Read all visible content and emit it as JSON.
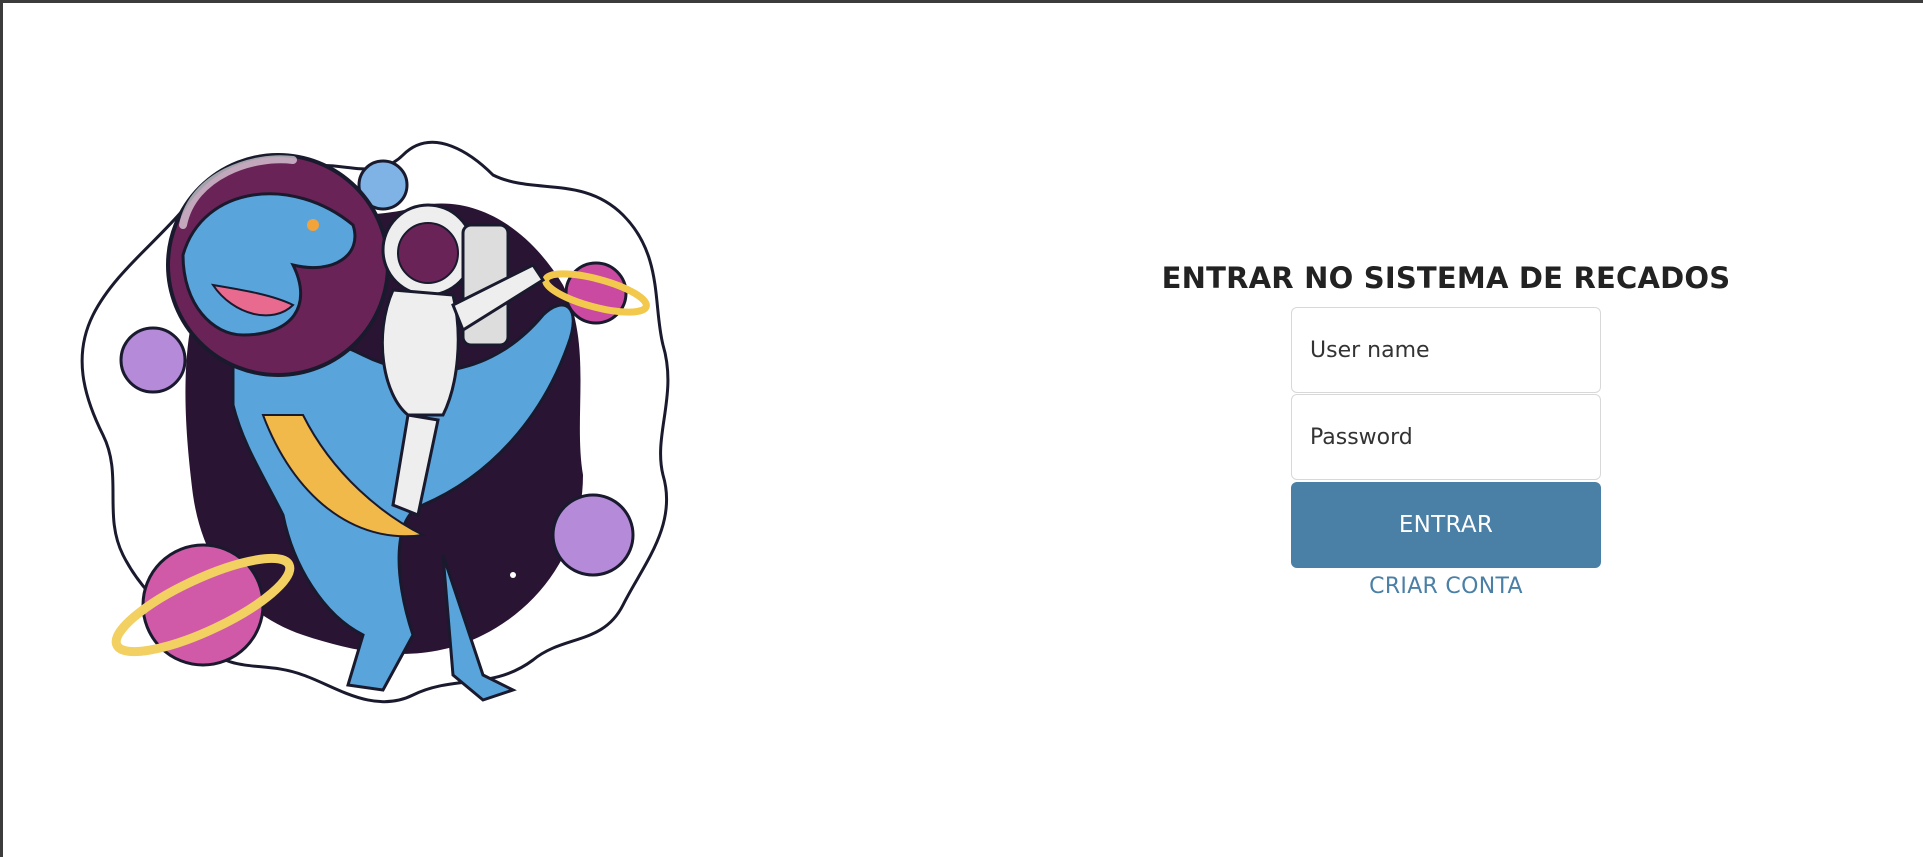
{
  "login": {
    "title": "ENTRAR NO SISTEMA DE RECADOS",
    "username_placeholder": "User name",
    "password_placeholder": "Password",
    "enter_label": "ENTRAR",
    "create_account_label": "CRIAR CONTA"
  },
  "colors": {
    "accent": "#4a7fa6",
    "title_text": "#222222",
    "input_border": "#d8d8d8"
  },
  "icons": {
    "hero": "dinosaur-astronaut-illustration"
  }
}
